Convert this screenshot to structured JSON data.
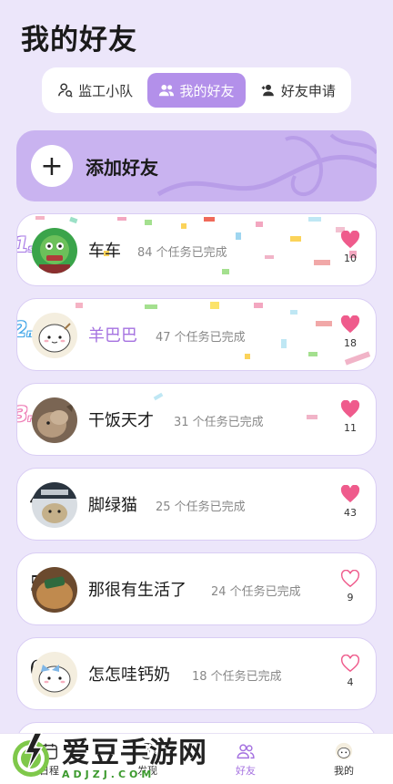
{
  "header": {
    "title": "我的好友"
  },
  "tabs": [
    {
      "label": "监工小队",
      "icon": "supervisor-icon",
      "active": false
    },
    {
      "label": "我的好友",
      "icon": "friends-icon",
      "active": true
    },
    {
      "label": "好友申请",
      "icon": "add-friend-icon",
      "active": false
    }
  ],
  "add_friend": {
    "plus": "+",
    "label": "添加好友"
  },
  "friends": [
    {
      "rank": "1",
      "name": "车车",
      "tasks": "84 个任务已完成",
      "likes": "10",
      "liked": true
    },
    {
      "rank": "2",
      "name": "羊巴巴",
      "tasks": "47 个任务已完成",
      "likes": "18",
      "liked": true
    },
    {
      "rank": "3",
      "name": "干饭天才",
      "tasks": "31 个任务已完成",
      "likes": "11",
      "liked": true
    },
    {
      "rank": "4",
      "name": "脚绿猫",
      "tasks": "25 个任务已完成",
      "likes": "43",
      "liked": true
    },
    {
      "rank": "5",
      "name": "那很有生活了",
      "tasks": "24 个任务已完成",
      "likes": "9",
      "liked": false
    },
    {
      "rank": "6",
      "name": "怎怎哇钙奶",
      "tasks": "18 个任务已完成",
      "likes": "4",
      "liked": false
    }
  ],
  "medal_suffix": {
    "1": "st",
    "2": "nd",
    "3": "rd"
  },
  "bottom_nav": [
    {
      "label": "日程",
      "icon": "calendar-icon",
      "active": false
    },
    {
      "label": "发现",
      "icon": "discover-icon",
      "active": false
    },
    {
      "label": "好友",
      "icon": "friends-icon",
      "active": true
    },
    {
      "label": "我的",
      "icon": "profile-icon",
      "active": false
    }
  ],
  "watermark": {
    "main": "爱豆手游网",
    "sub": "ADJZJ.COM"
  },
  "colors": {
    "accent": "#b390ea",
    "heart_filled": "#ef5b8c",
    "heart_outline": "#ef5b8c",
    "background": "#ece6fa"
  }
}
